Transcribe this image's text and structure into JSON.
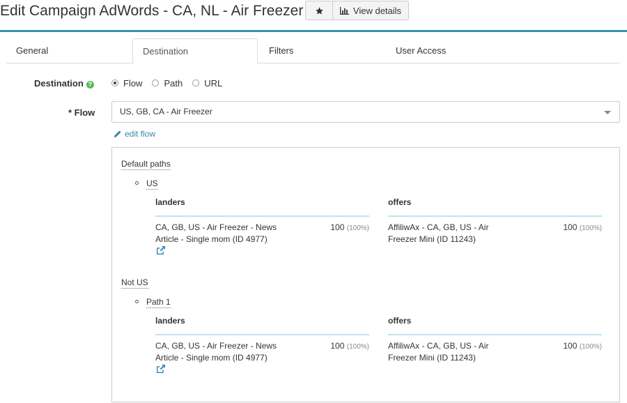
{
  "header": {
    "title": "Edit Campaign AdWords - CA, NL - Air Freezer",
    "view_details": "View details"
  },
  "tabs": [
    {
      "label": "General",
      "active": false
    },
    {
      "label": "Destination",
      "active": true
    },
    {
      "label": "Filters",
      "active": false
    },
    {
      "label": "User Access",
      "active": false
    }
  ],
  "destination": {
    "label": "Destination",
    "options": [
      "Flow",
      "Path",
      "URL"
    ],
    "selected": "Flow"
  },
  "flow": {
    "label": "* Flow",
    "value": "US, GB, CA - Air Freezer",
    "edit_label": "edit flow"
  },
  "panel": {
    "default_paths_label": "Default paths",
    "groups": [
      {
        "name": "US",
        "landers_header": "landers",
        "offers_header": "offers",
        "lander": {
          "name": "CA, GB, US - Air Freezer - News Article - Single mom (ID 4977)",
          "weight": "100",
          "pct": "(100%)"
        },
        "offer": {
          "name": "AffiliwAx - CA, GB, US - Air Freezer Mini (ID 11243)",
          "weight": "100",
          "pct": "(100%)"
        }
      },
      {
        "section": "Not US",
        "name": "Path 1",
        "landers_header": "landers",
        "offers_header": "offers",
        "lander": {
          "name": "CA, GB, US - Air Freezer - News Article - Single mom (ID 4977)",
          "weight": "100",
          "pct": "(100%)"
        },
        "offer": {
          "name": "AffiliwAx - CA, GB, US - Air Freezer Mini (ID 11243)",
          "weight": "100",
          "pct": "(100%)"
        }
      }
    ]
  },
  "colors": {
    "accent": "#3a8fb7",
    "link": "#3a87ad",
    "help": "#5cb85c",
    "rule": "#bfe3ee"
  }
}
